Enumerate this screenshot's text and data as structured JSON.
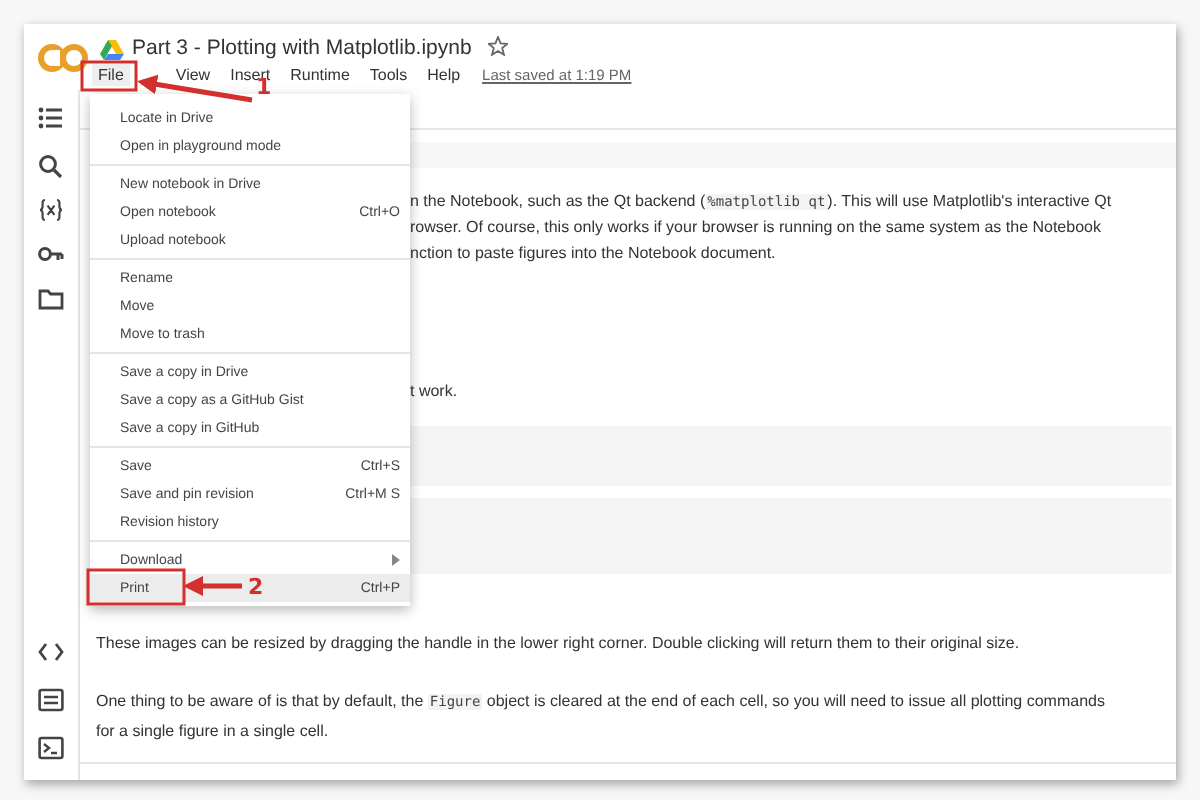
{
  "notebook": {
    "title": "Part 3 - Plotting with Matplotlib.ipynb",
    "starred": false
  },
  "menubar": {
    "items": [
      {
        "label": "File",
        "selected": true
      },
      {
        "label": "View",
        "selected": false
      },
      {
        "label": "Insert",
        "selected": false
      },
      {
        "label": "Runtime",
        "selected": false
      },
      {
        "label": "Tools",
        "selected": false
      },
      {
        "label": "Help",
        "selected": false
      }
    ],
    "last_saved": "Last saved at 1:19 PM"
  },
  "file_menu": {
    "groups": [
      {
        "items": [
          {
            "label": "Locate in Drive",
            "selected": false,
            "submenu": false
          },
          {
            "label": "Open in playground mode",
            "selected": false,
            "submenu": false
          }
        ]
      },
      {
        "items": [
          {
            "label": "New notebook in Drive",
            "selected": false,
            "submenu": false
          },
          {
            "label": "Open notebook",
            "shortcut": "Ctrl+O",
            "selected": false,
            "submenu": false
          },
          {
            "label": "Upload notebook",
            "selected": false,
            "submenu": false
          }
        ]
      },
      {
        "items": [
          {
            "label": "Rename",
            "selected": false,
            "submenu": false
          },
          {
            "label": "Move",
            "selected": false,
            "submenu": false
          },
          {
            "label": "Move to trash",
            "selected": false,
            "submenu": false
          }
        ]
      },
      {
        "items": [
          {
            "label": "Save a copy in Drive",
            "selected": false,
            "submenu": false
          },
          {
            "label": "Save a copy as a GitHub Gist",
            "selected": false,
            "submenu": false
          },
          {
            "label": "Save a copy in GitHub",
            "selected": false,
            "submenu": false
          }
        ]
      },
      {
        "items": [
          {
            "label": "Save",
            "shortcut": "Ctrl+S",
            "selected": false,
            "submenu": false
          },
          {
            "label": "Save and pin revision",
            "shortcut": "Ctrl+M S",
            "selected": false,
            "submenu": false
          },
          {
            "label": "Revision history",
            "selected": false,
            "submenu": false
          }
        ]
      },
      {
        "items": [
          {
            "label": "Download",
            "selected": false,
            "submenu": true
          },
          {
            "label": "Print",
            "shortcut": "Ctrl+P",
            "selected": true,
            "submenu": false
          }
        ]
      }
    ]
  },
  "content": {
    "top_lines": [
      [
        {
          "kind": "text",
          "text": "n the Notebook, such as the Qt backend ("
        },
        {
          "kind": "code",
          "text": "%matplotlib qt"
        },
        {
          "kind": "text",
          "text": "). This will use Matplotlib's interactive Qt"
        }
      ],
      [
        {
          "kind": "text",
          "text": "rowser. Of course, this only works if your browser is running on the same system as the Notebook"
        }
      ],
      [
        {
          "kind": "text",
          "text": "nction to paste figures into the Notebook document."
        }
      ]
    ],
    "fragment": "t work.",
    "paragraphs": [
      [
        {
          "kind": "text",
          "text": "These images can be resized by dragging the handle in the lower right corner. Double clicking will return them to their original size."
        }
      ],
      [
        {
          "kind": "text",
          "text": "One thing to be aware of is that by default, the "
        },
        {
          "kind": "code",
          "text": "Figure"
        },
        {
          "kind": "text",
          "text": " object is cleared at the end of each cell, so you will need to issue all plotting commands for a single figure in a single cell."
        }
      ]
    ]
  },
  "annotations": [
    {
      "label": "1"
    },
    {
      "label": "2"
    }
  ]
}
